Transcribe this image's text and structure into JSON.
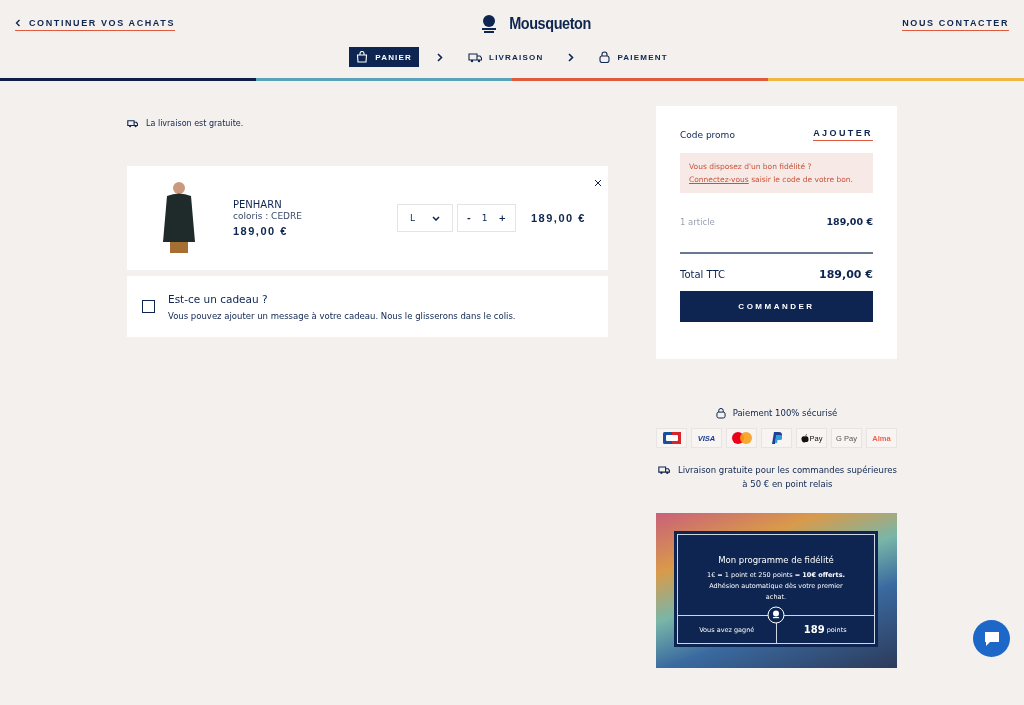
{
  "header": {
    "back_link": "CONTINUER VOS ACHATS",
    "logo": "Mousqueton",
    "contact_link": "NOUS CONTACTER"
  },
  "steps": [
    {
      "label": "PANIER",
      "kind": "cart",
      "selected": true
    },
    {
      "label": "LIVRAISON",
      "kind": "delivery",
      "selected": false
    },
    {
      "label": "PAIEMENT",
      "kind": "payment",
      "selected": false
    }
  ],
  "shipping_note": "La livraison est gratuite.",
  "cart_items": [
    {
      "name": "PENHARN",
      "color_label": "coloris : CEDRE",
      "unit_price": "189,00 €",
      "size": "L",
      "quantity": "1",
      "minus": "-",
      "plus": "+",
      "total": "189,00 €"
    }
  ],
  "gift": {
    "title": "Est-ce un cadeau ?",
    "description": "Vous pouvez ajouter un message à votre cadeau. Nous le glisserons dans le colis.",
    "checked": false
  },
  "summary": {
    "promo_label": "Code promo",
    "promo_action": "AJOUTER",
    "loyalty_notice": "Vous disposez d'un bon fidélité ?",
    "login_link": "Connectez-vous",
    "login_rest": "saisir le code de votre bon.",
    "items_label": "1 article",
    "items_price": "189,00 €",
    "total_label": "Total TTC",
    "total_price": "189,00 €",
    "order_button": "COMMANDER"
  },
  "secure_payment": "Paiement 100% sécurisé",
  "payment_methods": [
    {
      "kind": "cb"
    },
    {
      "kind": "text",
      "label": "VISA"
    },
    {
      "kind": "mastercard"
    },
    {
      "kind": "paypal"
    },
    {
      "kind": "applepay",
      "label": "Pay"
    },
    {
      "kind": "text",
      "label": "G Pay"
    },
    {
      "kind": "text",
      "label": "Alma"
    }
  ],
  "free_shipping_info": "Livraison gratuite pour les commandes supérieures à 50 € en point relais",
  "loyalty": {
    "title": "Mon programme de fidélité",
    "description": "1€ = 1 point et 250 points = **10€ offerts.** Adhésion automatique dès votre premier achat.",
    "earned_label": "Vous avez gagné",
    "points": "**189** points"
  }
}
